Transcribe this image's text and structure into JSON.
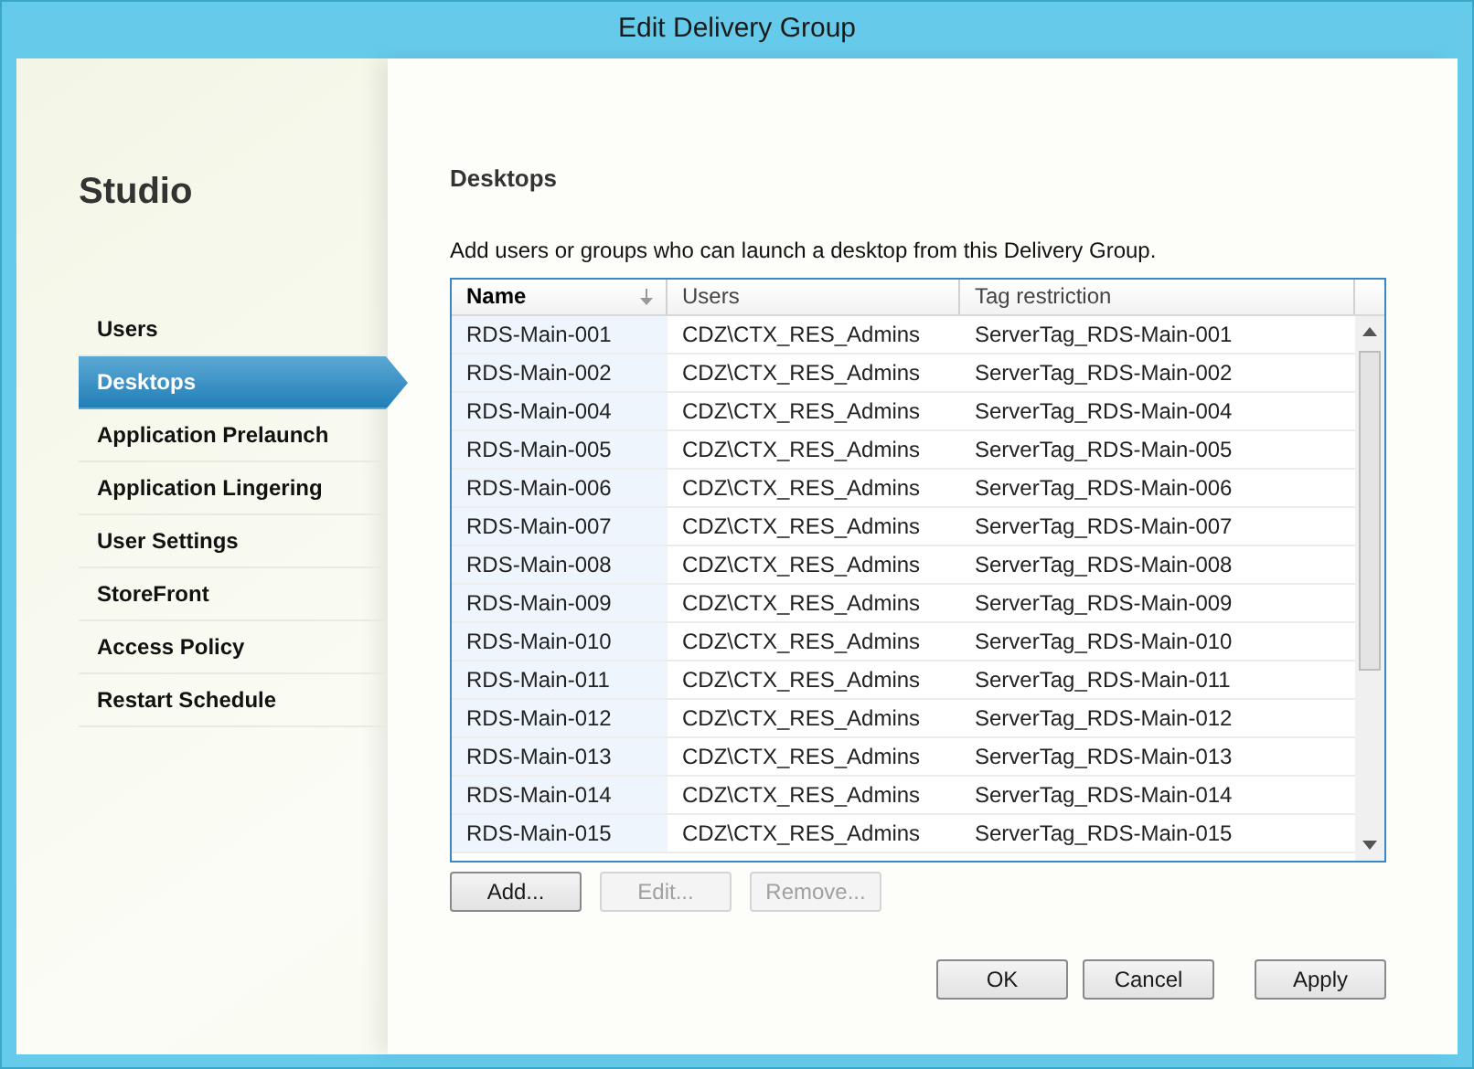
{
  "window": {
    "title": "Edit Delivery Group"
  },
  "sidebar": {
    "title": "Studio",
    "items": [
      {
        "label": "Users",
        "selected": false
      },
      {
        "label": "Desktops",
        "selected": true
      },
      {
        "label": "Application Prelaunch",
        "selected": false
      },
      {
        "label": "Application Lingering",
        "selected": false
      },
      {
        "label": "User Settings",
        "selected": false
      },
      {
        "label": "StoreFront",
        "selected": false
      },
      {
        "label": "Access Policy",
        "selected": false
      },
      {
        "label": "Restart Schedule",
        "selected": false
      }
    ]
  },
  "page": {
    "heading": "Desktops",
    "description": "Add users or groups who can launch a desktop from this Delivery Group."
  },
  "table": {
    "columns": [
      "Name",
      "Users",
      "Tag restriction"
    ],
    "rows": [
      [
        "RDS-Main-001",
        "CDZ\\CTX_RES_Admins",
        "ServerTag_RDS-Main-001"
      ],
      [
        "RDS-Main-002",
        "CDZ\\CTX_RES_Admins",
        "ServerTag_RDS-Main-002"
      ],
      [
        "RDS-Main-004",
        "CDZ\\CTX_RES_Admins",
        "ServerTag_RDS-Main-004"
      ],
      [
        "RDS-Main-005",
        "CDZ\\CTX_RES_Admins",
        "ServerTag_RDS-Main-005"
      ],
      [
        "RDS-Main-006",
        "CDZ\\CTX_RES_Admins",
        "ServerTag_RDS-Main-006"
      ],
      [
        "RDS-Main-007",
        "CDZ\\CTX_RES_Admins",
        "ServerTag_RDS-Main-007"
      ],
      [
        "RDS-Main-008",
        "CDZ\\CTX_RES_Admins",
        "ServerTag_RDS-Main-008"
      ],
      [
        "RDS-Main-009",
        "CDZ\\CTX_RES_Admins",
        "ServerTag_RDS-Main-009"
      ],
      [
        "RDS-Main-010",
        "CDZ\\CTX_RES_Admins",
        "ServerTag_RDS-Main-010"
      ],
      [
        "RDS-Main-011",
        "CDZ\\CTX_RES_Admins",
        "ServerTag_RDS-Main-011"
      ],
      [
        "RDS-Main-012",
        "CDZ\\CTX_RES_Admins",
        "ServerTag_RDS-Main-012"
      ],
      [
        "RDS-Main-013",
        "CDZ\\CTX_RES_Admins",
        "ServerTag_RDS-Main-013"
      ],
      [
        "RDS-Main-014",
        "CDZ\\CTX_RES_Admins",
        "ServerTag_RDS-Main-014"
      ],
      [
        "RDS-Main-015",
        "CDZ\\CTX_RES_Admins",
        "ServerTag_RDS-Main-015"
      ]
    ]
  },
  "table_buttons": [
    {
      "label": "Add...",
      "disabled": false
    },
    {
      "label": "Edit...",
      "disabled": true
    },
    {
      "label": "Remove...",
      "disabled": true
    }
  ],
  "dialog_buttons": [
    {
      "label": "OK"
    },
    {
      "label": "Cancel"
    },
    {
      "label": "Apply"
    }
  ]
}
